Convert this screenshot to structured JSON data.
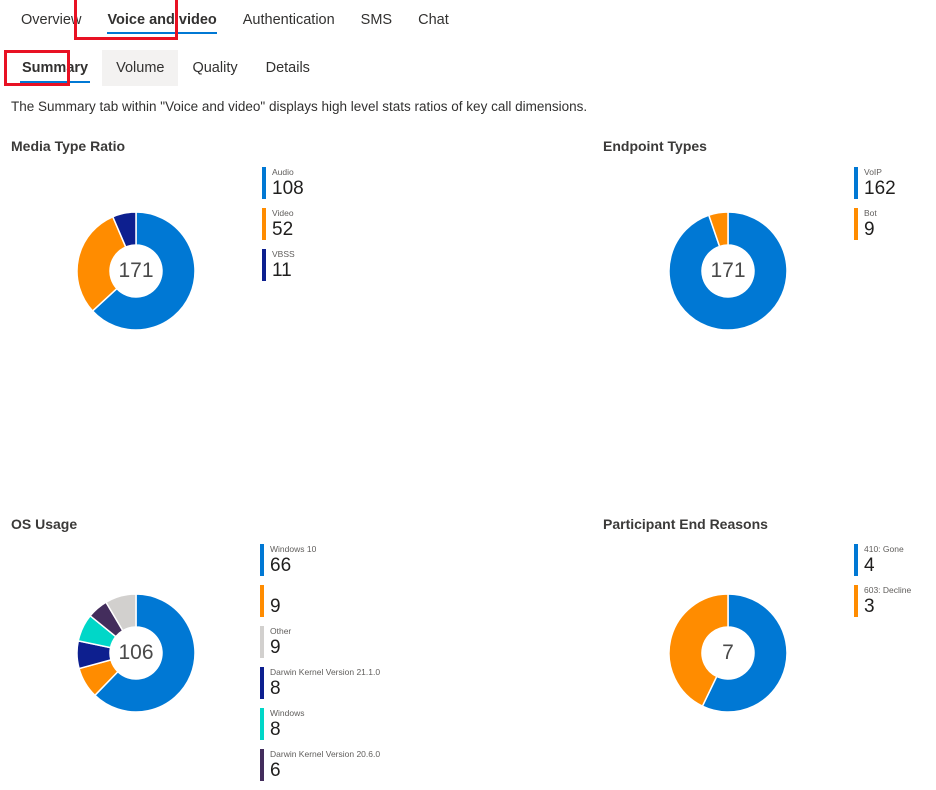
{
  "primary_tabs": [
    {
      "label": "Overview",
      "active": false
    },
    {
      "label": "Voice and video",
      "active": true
    },
    {
      "label": "Authentication",
      "active": false
    },
    {
      "label": "SMS",
      "active": false
    },
    {
      "label": "Chat",
      "active": false
    }
  ],
  "secondary_tabs": [
    {
      "label": "Summary",
      "active": true,
      "hovered": false
    },
    {
      "label": "Volume",
      "active": false,
      "hovered": true
    },
    {
      "label": "Quality",
      "active": false,
      "hovered": false
    },
    {
      "label": "Details",
      "active": false,
      "hovered": false
    }
  ],
  "description": "The Summary tab within \"Voice and video\" displays high level stats ratios of key call dimensions.",
  "colors": {
    "accent_blue": "#0078d4",
    "orange": "#ff8c00",
    "navy": "#0d1f8f",
    "gray": "#d2d0ce",
    "teal": "#00d7c8",
    "purple": "#432d5c",
    "annotation_red": "#e81123",
    "underline_blue": "#0078d4"
  },
  "chart_data": [
    {
      "type": "pie",
      "title": "Media Type Ratio",
      "center_total": "171",
      "categories": [
        "Audio",
        "Video",
        "VBSS"
      ],
      "values": [
        108,
        52,
        11
      ],
      "colors": [
        "#0078d4",
        "#ff8c00",
        "#0d1f8f"
      ],
      "legend_position": "right"
    },
    {
      "type": "pie",
      "title": "Endpoint Types",
      "center_total": "171",
      "categories": [
        "VoIP",
        "Bot"
      ],
      "values": [
        162,
        9
      ],
      "colors": [
        "#0078d4",
        "#ff8c00"
      ],
      "legend_position": "right"
    },
    {
      "type": "pie",
      "title": "OS Usage",
      "center_total": "106",
      "categories": [
        "Windows 10",
        "",
        "Other",
        "Darwin Kernel Version 21.1.0",
        "Windows",
        "Darwin Kernel Version 20.6.0"
      ],
      "values": [
        66,
        9,
        9,
        8,
        8,
        6
      ],
      "colors": [
        "#0078d4",
        "#ff8c00",
        "#d2d0ce",
        "#0d1f8f",
        "#00d7c8",
        "#432d5c"
      ],
      "legend_order": [
        "Windows 10",
        "",
        "Other",
        "Darwin Kernel Version 21.1.0",
        "Windows",
        "Darwin Kernel Version 20.6.0"
      ],
      "slice_order_clockwise_from_top": [
        "Windows 10",
        "",
        "Darwin Kernel Version 21.1.0",
        "Windows",
        "Darwin Kernel Version 20.6.0",
        "Other"
      ],
      "legend_position": "right"
    },
    {
      "type": "pie",
      "title": "Participant End Reasons",
      "center_total": "7",
      "categories": [
        "410: Gone",
        "603: Decline"
      ],
      "values": [
        4,
        3
      ],
      "colors": [
        "#0078d4",
        "#ff8c00"
      ],
      "legend_position": "right"
    }
  ]
}
